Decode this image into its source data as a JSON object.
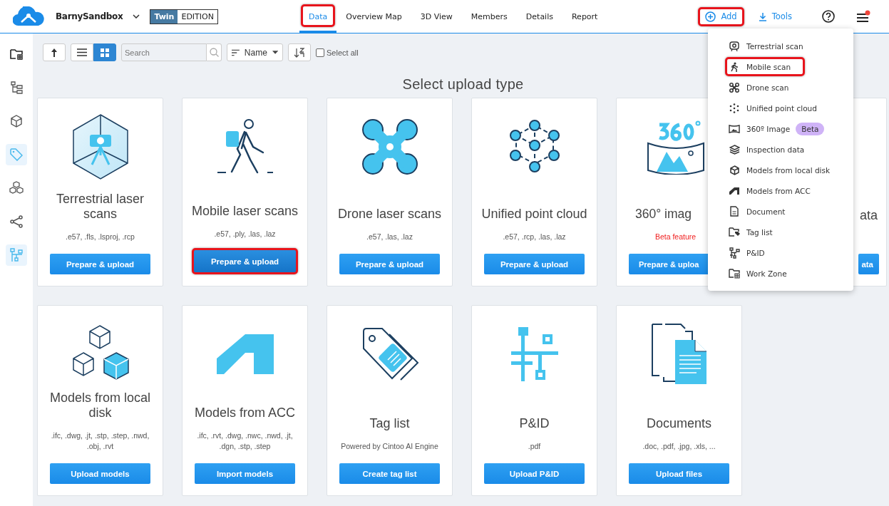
{
  "header": {
    "workspace": "BarnySandbox",
    "edition": {
      "brand": "Twin",
      "label": "EDITION"
    },
    "tabs": [
      {
        "label": "Data",
        "selected": true,
        "highlighted": true
      },
      {
        "label": "Overview Map",
        "selected": false,
        "highlighted": false
      },
      {
        "label": "3D View",
        "selected": false,
        "highlighted": false
      },
      {
        "label": "Members",
        "selected": false,
        "highlighted": false
      },
      {
        "label": "Details",
        "selected": false,
        "highlighted": false
      },
      {
        "label": "Report",
        "selected": false,
        "highlighted": false
      }
    ],
    "add_button": {
      "label": "Add",
      "highlighted": true
    },
    "tools_button": {
      "label": "Tools"
    },
    "menu_notification": true
  },
  "sidebar": {
    "items": [
      {
        "kind": "workzone",
        "selected": false
      },
      {
        "kind": "tree",
        "selected": false
      },
      {
        "kind": "cube",
        "selected": false
      },
      {
        "kind": "tag",
        "selected": true
      },
      {
        "kind": "cubes",
        "selected": false
      },
      {
        "kind": "share",
        "selected": false
      },
      {
        "kind": "pid",
        "selected": true
      }
    ]
  },
  "toolbar": {
    "view": [
      {
        "kind": "list",
        "selected": false
      },
      {
        "kind": "grid",
        "selected": true
      }
    ],
    "search": {
      "placeholder": "Search"
    },
    "sort": {
      "label": "Name"
    },
    "select_all": {
      "label": "Select all",
      "checked": false
    }
  },
  "heading": "Select upload type",
  "cards": [
    {
      "kind": "terrestrial",
      "title": "Terrestrial laser scans",
      "subtitle": ".e57, .fls, .lsproj, .rcp",
      "subtitle_alert": false,
      "button": "Prepare & upload",
      "highlighted": false,
      "cut": false
    },
    {
      "kind": "mobile",
      "title": "Mobile laser scans",
      "subtitle": ".e57, .ply, .las, .laz",
      "subtitle_alert": false,
      "button": "Prepare & upload",
      "highlighted": true,
      "cut": false
    },
    {
      "kind": "drone",
      "title": "Drone laser scans",
      "subtitle": ".e57, .las, .laz",
      "subtitle_alert": false,
      "button": "Prepare & upload",
      "highlighted": false,
      "cut": false
    },
    {
      "kind": "cloud",
      "title": "Unified point cloud",
      "subtitle": ".e57, .rcp, .las, .laz",
      "subtitle_alert": false,
      "button": "Prepare & upload",
      "highlighted": false,
      "cut": false
    },
    {
      "kind": "image360",
      "title": "360° imag",
      "subtitle": "Beta feature",
      "subtitle_alert": true,
      "button": "Prepare & uploa",
      "highlighted": false,
      "cut": true
    },
    {
      "kind": "covered",
      "title": "ata",
      "button": "ata",
      "highlighted": false,
      "cut": false
    },
    {
      "kind": "models",
      "title": "Models from local disk",
      "subtitle": ".ifc, .dwg, .jt, .stp, .step, .nwd, .obj, .rvt",
      "subtitle_alert": false,
      "button": "Upload models",
      "highlighted": false,
      "cut": false
    },
    {
      "kind": "acc",
      "title": "Models from ACC",
      "subtitle": ".ifc, .rvt, .dwg, .nwc, .nwd, .jt, .dgn, .stp, .step",
      "subtitle_alert": false,
      "button": "Import models",
      "highlighted": false,
      "cut": false
    },
    {
      "kind": "tag",
      "title": "Tag list",
      "subtitle": "Powered by Cintoo AI Engine",
      "subtitle_alert": false,
      "button": "Create tag list",
      "highlighted": false,
      "cut": false
    },
    {
      "kind": "pid",
      "title": "P&ID",
      "subtitle": ".pdf",
      "subtitle_alert": false,
      "button": "Upload P&ID",
      "highlighted": false,
      "cut": false
    },
    {
      "kind": "docs",
      "title": "Documents",
      "subtitle": ".doc, .pdf, .jpg, .xls, ...",
      "subtitle_alert": false,
      "button": "Upload files",
      "highlighted": false,
      "cut": false
    }
  ],
  "add_menu": {
    "items": [
      {
        "kind": "terrestrial",
        "label": "Terrestrial scan",
        "highlighted": false
      },
      {
        "kind": "mobile",
        "label": "Mobile scan",
        "highlighted": true
      },
      {
        "kind": "drone",
        "label": "Drone scan",
        "highlighted": false
      },
      {
        "kind": "cloud",
        "label": "Unified point cloud",
        "highlighted": false
      },
      {
        "kind": "image360",
        "label": "360º Image",
        "badge": "Beta",
        "highlighted": false
      },
      {
        "kind": "layers",
        "label": "Inspection data",
        "highlighted": false
      },
      {
        "kind": "cube",
        "label": "Models from local disk",
        "highlighted": false
      },
      {
        "kind": "acc",
        "label": "Models from ACC",
        "highlighted": false
      },
      {
        "kind": "doc",
        "label": "Document",
        "highlighted": false
      },
      {
        "kind": "tag",
        "label": "Tag list",
        "highlighted": false
      },
      {
        "kind": "pid",
        "label": "P&ID",
        "highlighted": false
      },
      {
        "kind": "workzone",
        "label": "Work Zone",
        "highlighted": false
      }
    ]
  }
}
